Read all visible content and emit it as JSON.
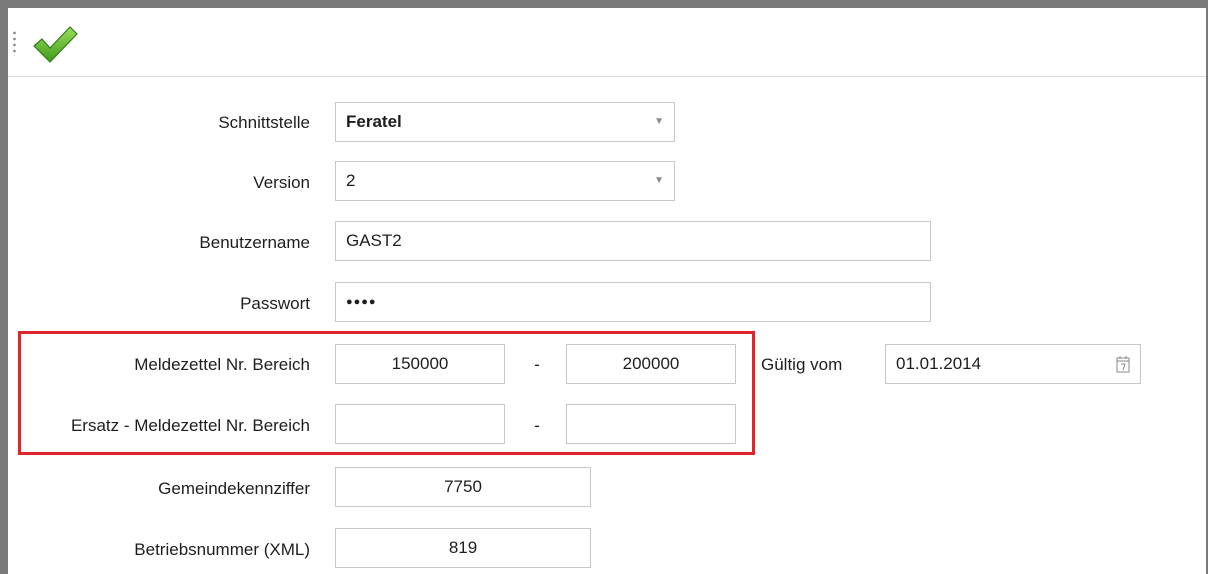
{
  "toolbar": {
    "confirm_icon": "checkmark-icon",
    "accent": "#5cb82a"
  },
  "form": {
    "schnittstelle": {
      "label": "Schnittstelle",
      "value": "Feratel"
    },
    "version": {
      "label": "Version",
      "value": "2"
    },
    "benutzername": {
      "label": "Benutzername",
      "value": "GAST2"
    },
    "passwort": {
      "label": "Passwort",
      "value": "●●●●"
    },
    "meldezettel": {
      "label": "Meldezettel Nr. Bereich",
      "from": "150000",
      "separator": "-",
      "to": "200000"
    },
    "gueltig_vom": {
      "label": "Gültig vom",
      "value": "01.01.2014"
    },
    "ersatz": {
      "label": "Ersatz - Meldezettel Nr. Bereich",
      "from": "",
      "separator": "-",
      "to": ""
    },
    "gemeindekennziffer": {
      "label": "Gemeindekennziffer",
      "value": "7750"
    },
    "betriebsnummer": {
      "label": "Betriebsnummer (XML)",
      "value": "819"
    }
  },
  "highlight_color": "#e0242c"
}
